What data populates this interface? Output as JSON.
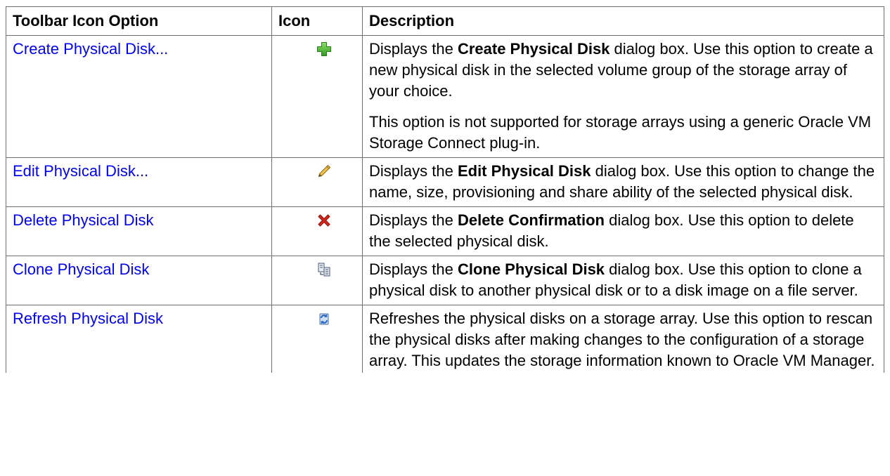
{
  "table": {
    "headers": {
      "option": "Toolbar Icon Option",
      "icon": "Icon",
      "description": "Description"
    },
    "rows": [
      {
        "option": "Create Physical Disk...",
        "icon": "add-plus-icon",
        "desc_pre": "Displays the ",
        "desc_bold": "Create Physical Disk",
        "desc_post": " dialog box. Use this option to create a new physical disk in the selected volume group of the storage array of your choice.",
        "note": "This option is not supported for storage arrays using a generic Oracle VM Storage Connect plug-in."
      },
      {
        "option": "Edit Physical Disk...",
        "icon": "pencil-edit-icon",
        "desc_pre": "Displays the ",
        "desc_bold": "Edit Physical Disk",
        "desc_post": " dialog box. Use this option to change the name, size, provisioning and share ability of the selected physical disk."
      },
      {
        "option": "Delete Physical Disk",
        "icon": "delete-x-icon",
        "desc_pre": "Displays the ",
        "desc_bold": "Delete Confirmation",
        "desc_post": " dialog box. Use this option to delete the selected physical disk."
      },
      {
        "option": "Clone Physical Disk",
        "icon": "clone-disk-icon",
        "desc_pre": "Displays the ",
        "desc_bold": "Clone Physical Disk",
        "desc_post": " dialog box. Use this option to clone a physical disk to another physical disk or to a disk image on a file server."
      },
      {
        "option": "Refresh Physical Disk",
        "icon": "refresh-icon",
        "desc_pre": "Refreshes the physical disks on a storage array. Use this option to rescan the physical disks after making changes to the configuration of a storage array. This updates the storage information known to Oracle VM Manager."
      }
    ]
  },
  "colors": {
    "link": "#0000ee",
    "border": "#6f6f6f",
    "add_icon_green": "#3fae2a",
    "delete_icon_red": "#d4261a",
    "refresh_icon_blue": "#3a7bd5"
  }
}
